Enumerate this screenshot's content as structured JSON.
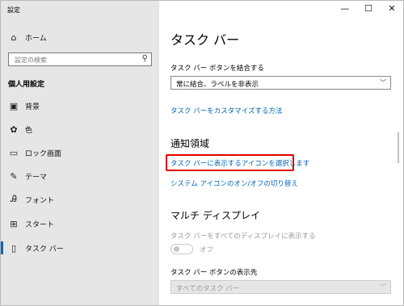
{
  "app": {
    "title": "設定"
  },
  "window_controls": {
    "minimize": "—",
    "maximize": "☐",
    "close": "✕"
  },
  "sidebar": {
    "home": {
      "label": "ホーム",
      "icon": "home-icon",
      "glyph": "⌂"
    },
    "search": {
      "placeholder": "設定の検索",
      "icon": "search-icon",
      "glyph": "⚲"
    },
    "section_header": "個人用設定",
    "items": [
      {
        "label": "背景",
        "icon": "picture-icon",
        "glyph": "▣"
      },
      {
        "label": "色",
        "icon": "palette-icon",
        "glyph": "✿"
      },
      {
        "label": "ロック画面",
        "icon": "monitor-icon",
        "glyph": "▭"
      },
      {
        "label": "テーマ",
        "icon": "theme-brush-icon",
        "glyph": "✎"
      },
      {
        "label": "フォント",
        "icon": "font-icon",
        "glyph": "Ꭿ"
      },
      {
        "label": "スタート",
        "icon": "start-tiles-icon",
        "glyph": "⊞"
      },
      {
        "label": "タスク バー",
        "icon": "taskbar-icon",
        "glyph": "▯",
        "active": true
      }
    ]
  },
  "main": {
    "title": "タスク バー",
    "combine_label": "タスク バー ボタンを結合する",
    "combine_value": "常に結合、ラベルを非表示",
    "customize_link": "タスク バーをカスタマイズする方法",
    "notification_header": "通知領域",
    "select_icons_link": "タスク バーに表示するアイコンを選択します",
    "system_icons_link": "システム アイコンのオン/オフの切り替え",
    "multi_display_header": "マルチ ディスプレイ",
    "show_all_displays_label": "タスク バーをすべてのディスプレイに表示する",
    "toggle_state": "オフ",
    "button_display_label": "タスク バー ボタンの表示先",
    "button_display_value": "すべてのタスク バー"
  },
  "colors": {
    "accent": "#0067b8",
    "highlight": "#e00000",
    "sidebar_bg": "#e6e6e6"
  }
}
